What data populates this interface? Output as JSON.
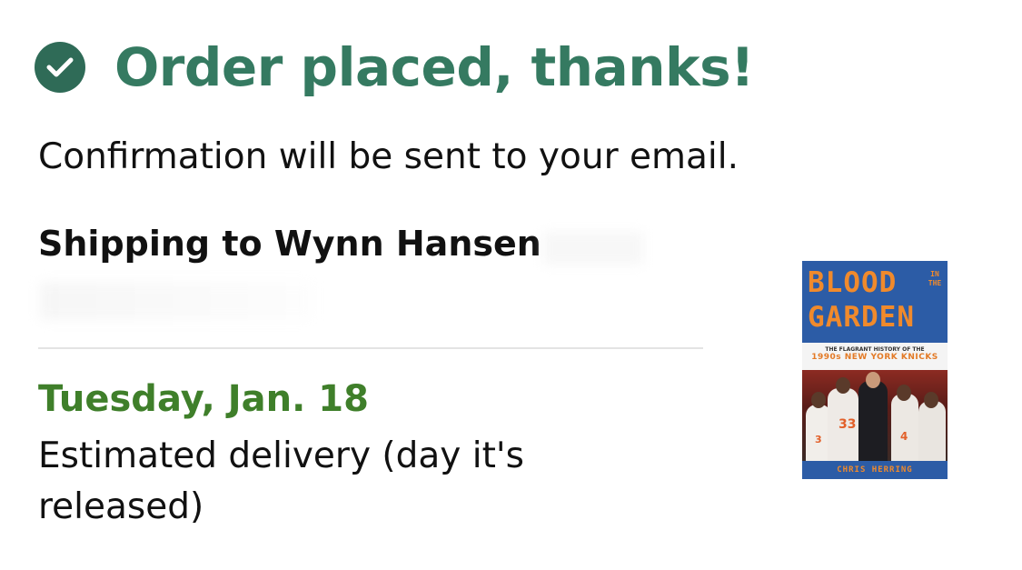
{
  "header": {
    "title": "Order placed, thanks!",
    "icon": "check-circle-icon",
    "accent_color": "#357a61"
  },
  "confirmation_text": "Confirmation will be sent to your email.",
  "shipping": {
    "label": "Shipping to Wynn Hansen"
  },
  "delivery": {
    "date": "Tuesday, Jan. 18",
    "date_color": "#3f7f2a",
    "note": "Estimated delivery (day it's released)"
  },
  "product": {
    "cover_title_line1": "BLOOD",
    "cover_title_inthe": "IN THE",
    "cover_title_line2": "GARDEN",
    "cover_subtitle1": "THE FLAGRANT HISTORY OF THE",
    "cover_subtitle2": "1990s NEW YORK KNICKS",
    "cover_author": "CHRIS HERRING",
    "jersey_33": "33",
    "jersey_3": "3",
    "jersey_4": "4"
  }
}
